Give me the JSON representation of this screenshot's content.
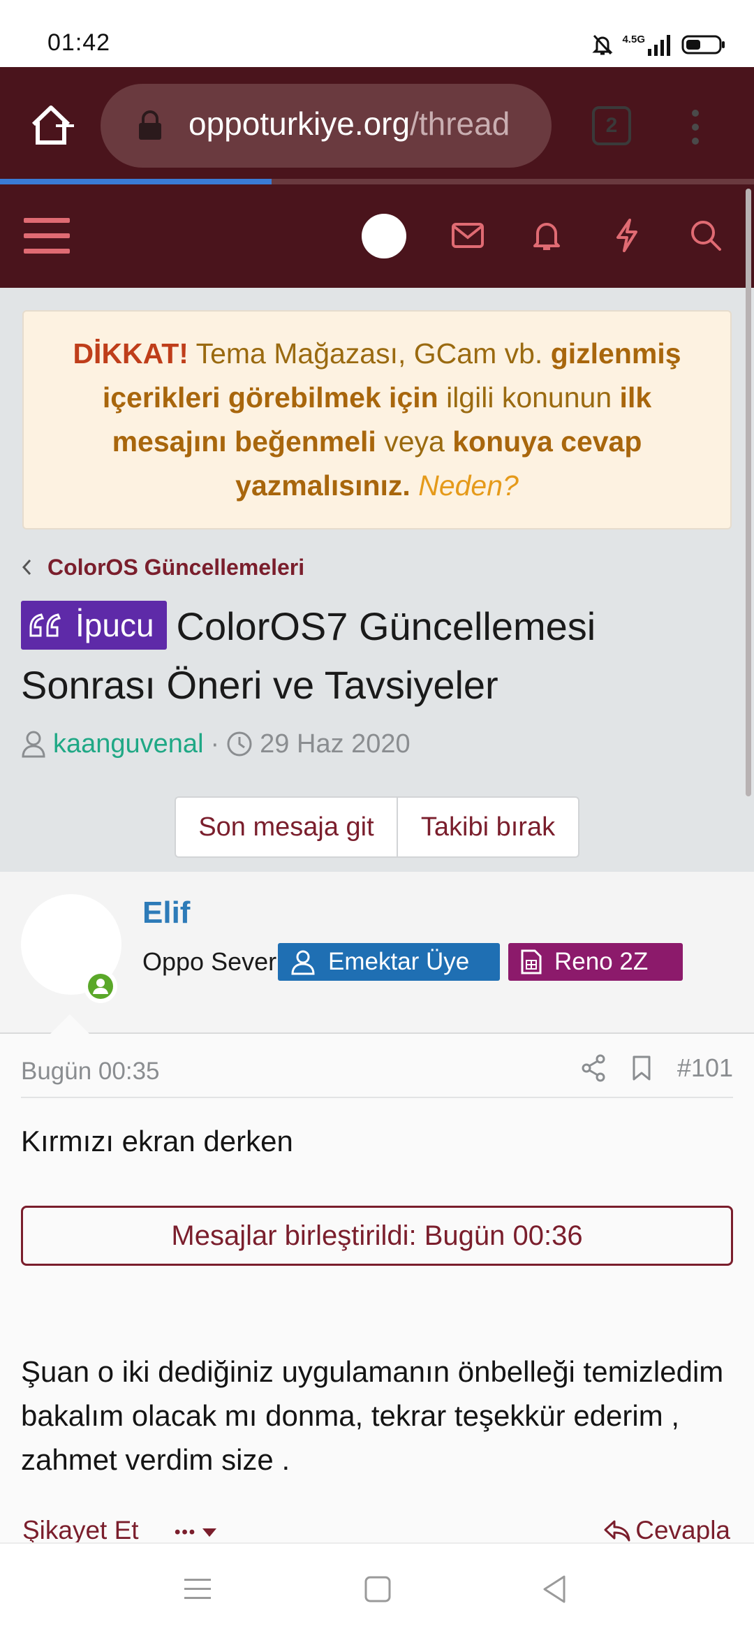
{
  "status_bar": {
    "time": "01:42",
    "network": "4.5G"
  },
  "browser": {
    "url_domain": "oppoturkiye.org",
    "url_path": "/thread",
    "tab_count": "2",
    "load_progress": 0.36
  },
  "notice": {
    "dikkat": "DİKKAT!",
    "part1": " Tema Mağazası, GCam vb. ",
    "bold1": "gizlenmiş içerikleri görebilmek için",
    "part2": " ilgili konunun ",
    "bold2": "ilk mesajını beğenmeli",
    "part3": " veya ",
    "bold3": "konuya cevap yazmalısınız.",
    "why": "Neden?"
  },
  "breadcrumb": {
    "label": "ColorOS Güncellemeleri"
  },
  "thread": {
    "prefix": "İpucu",
    "title": "ColorOS7 Güncellemesi Sonrası Öneri ve Tavsiyeler",
    "author": "kaanguvenal",
    "separator": "·",
    "date": "29 Haz 2020"
  },
  "buttons": {
    "last_message": "Son mesaja git",
    "unfollow": "Takibi bırak"
  },
  "post": {
    "user_name": "Elif",
    "user_title": "Oppo Sever",
    "banner_member": "Emektar Üye",
    "banner_device": "Reno 2Z",
    "date": "Bugün 00:35",
    "number": "#101",
    "message_1": "Kırmızı ekran derken",
    "merged_notice": "Mesajlar birleştirildi: Bugün 00:36",
    "message_2": "Şuan o iki dediğiniz uygulamanın önbelleği temizledim bakalım olacak mı donma, tekrar teşekkür ederim , zahmet verdim size .",
    "report": "Şikayet Et",
    "more": "•••",
    "reply": "Cevapla"
  },
  "colors": {
    "brand_dark": "#4a141c",
    "accent": "#7a1e2c",
    "link_green": "#1fa885",
    "prefix_purple": "#5e2aa8",
    "banner_blue": "#1f6fb3",
    "banner_magenta": "#8c1a6b"
  },
  "icons": {
    "status": [
      "mute-icon",
      "signal-icon",
      "battery-icon"
    ],
    "browser": [
      "home-icon",
      "lock-icon",
      "tabs-icon",
      "menu-dots-icon"
    ],
    "header": [
      "hamburger-icon",
      "mail-icon",
      "bell-icon",
      "bolt-icon",
      "search-icon"
    ],
    "post": [
      "share-icon",
      "bookmark-icon",
      "reply-icon"
    ],
    "nav": [
      "recents-icon",
      "home-nav-icon",
      "back-icon"
    ]
  }
}
